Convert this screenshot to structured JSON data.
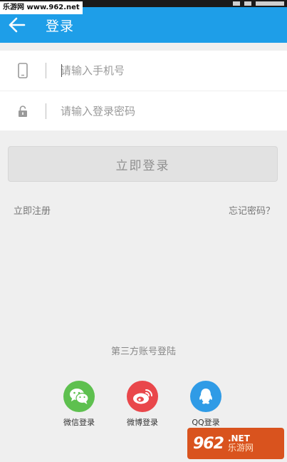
{
  "watermark": {
    "top_text": "乐游网 www.962.net",
    "brand_num": "962",
    "brand_net": ".NET",
    "brand_cn": "乐游网"
  },
  "header": {
    "title": "登录"
  },
  "form": {
    "phone_placeholder": "请输入手机号",
    "password_placeholder": "请输入登录密码"
  },
  "actions": {
    "login_label": "立即登录",
    "register_label": "立即注册",
    "forgot_label": "忘记密码？"
  },
  "third_party": {
    "title": "第三方账号登陆",
    "options": [
      {
        "label": "微信登录",
        "icon": "wechat-icon",
        "color": "#5ec04f"
      },
      {
        "label": "微博登录",
        "icon": "weibo-icon",
        "color": "#e9474b"
      },
      {
        "label": "QQ登录",
        "icon": "qq-icon",
        "color": "#2f9be6"
      }
    ]
  },
  "colors": {
    "accent": "#1e9ee8",
    "background": "#efefef"
  }
}
